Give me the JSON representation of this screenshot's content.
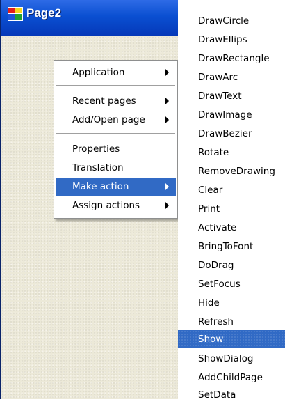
{
  "window": {
    "title": "Page2"
  },
  "context_menu": {
    "items": [
      {
        "label": "Application",
        "has_submenu": true
      },
      {
        "label": "Recent pages",
        "has_submenu": true
      },
      {
        "label": "Add/Open page",
        "has_submenu": true
      },
      {
        "label": "Properties",
        "has_submenu": false
      },
      {
        "label": "Translation",
        "has_submenu": false
      },
      {
        "label": "Make action",
        "has_submenu": true,
        "highlighted": true
      },
      {
        "label": "Assign actions",
        "has_submenu": true
      }
    ]
  },
  "action_submenu": {
    "items": [
      "DrawCircle",
      "DrawEllips",
      "DrawRectangle",
      "DrawArc",
      "DrawText",
      "DrawImage",
      "DrawBezier",
      "Rotate",
      "RemoveDrawing",
      "Clear",
      "Print",
      "Activate",
      "BringToFont",
      "DoDrag",
      "SetFocus",
      "Hide",
      "Refresh",
      "Show",
      "ShowDialog",
      "AddChildPage",
      "SetData"
    ],
    "highlighted": "Show"
  },
  "colors": {
    "titlebar": "#0a4fd1",
    "highlight": "#316ac5",
    "window_bg": "#ece9d8"
  }
}
